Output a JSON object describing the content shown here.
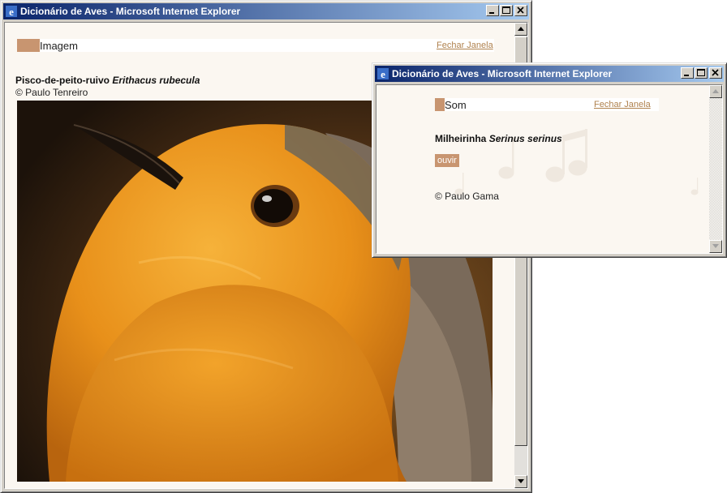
{
  "image_window": {
    "title": "Dicionário de Aves - Microsoft Internet Explorer",
    "section_title": "Imagem",
    "close_link": "Fechar Janela",
    "species_common": "Pisco-de-peito-ruivo",
    "species_scientific": "Erithacus rubecula",
    "credit": "© Paulo Tenreiro",
    "photo": "european-robin-photo"
  },
  "sound_window": {
    "title": "Dicionário de Aves - Microsoft Internet Explorer",
    "section_title": "Som",
    "close_link": "Fechar Janela",
    "species_common": "Milheirinha",
    "species_scientific": "Serinus serinus",
    "play_label": "ouvir",
    "credit": "© Paulo Gama"
  },
  "icons": [
    "ie-icon",
    "minimize-icon",
    "maximize-icon",
    "close-icon",
    "scroll-up-icon",
    "scroll-down-icon",
    "music-note-icon"
  ],
  "colors": {
    "titlebar_start": "#0a246a",
    "titlebar_end": "#a6caf0",
    "accent_tab": "#c89570",
    "link": "#b0824e",
    "page_bg": "#fbf7f1"
  }
}
